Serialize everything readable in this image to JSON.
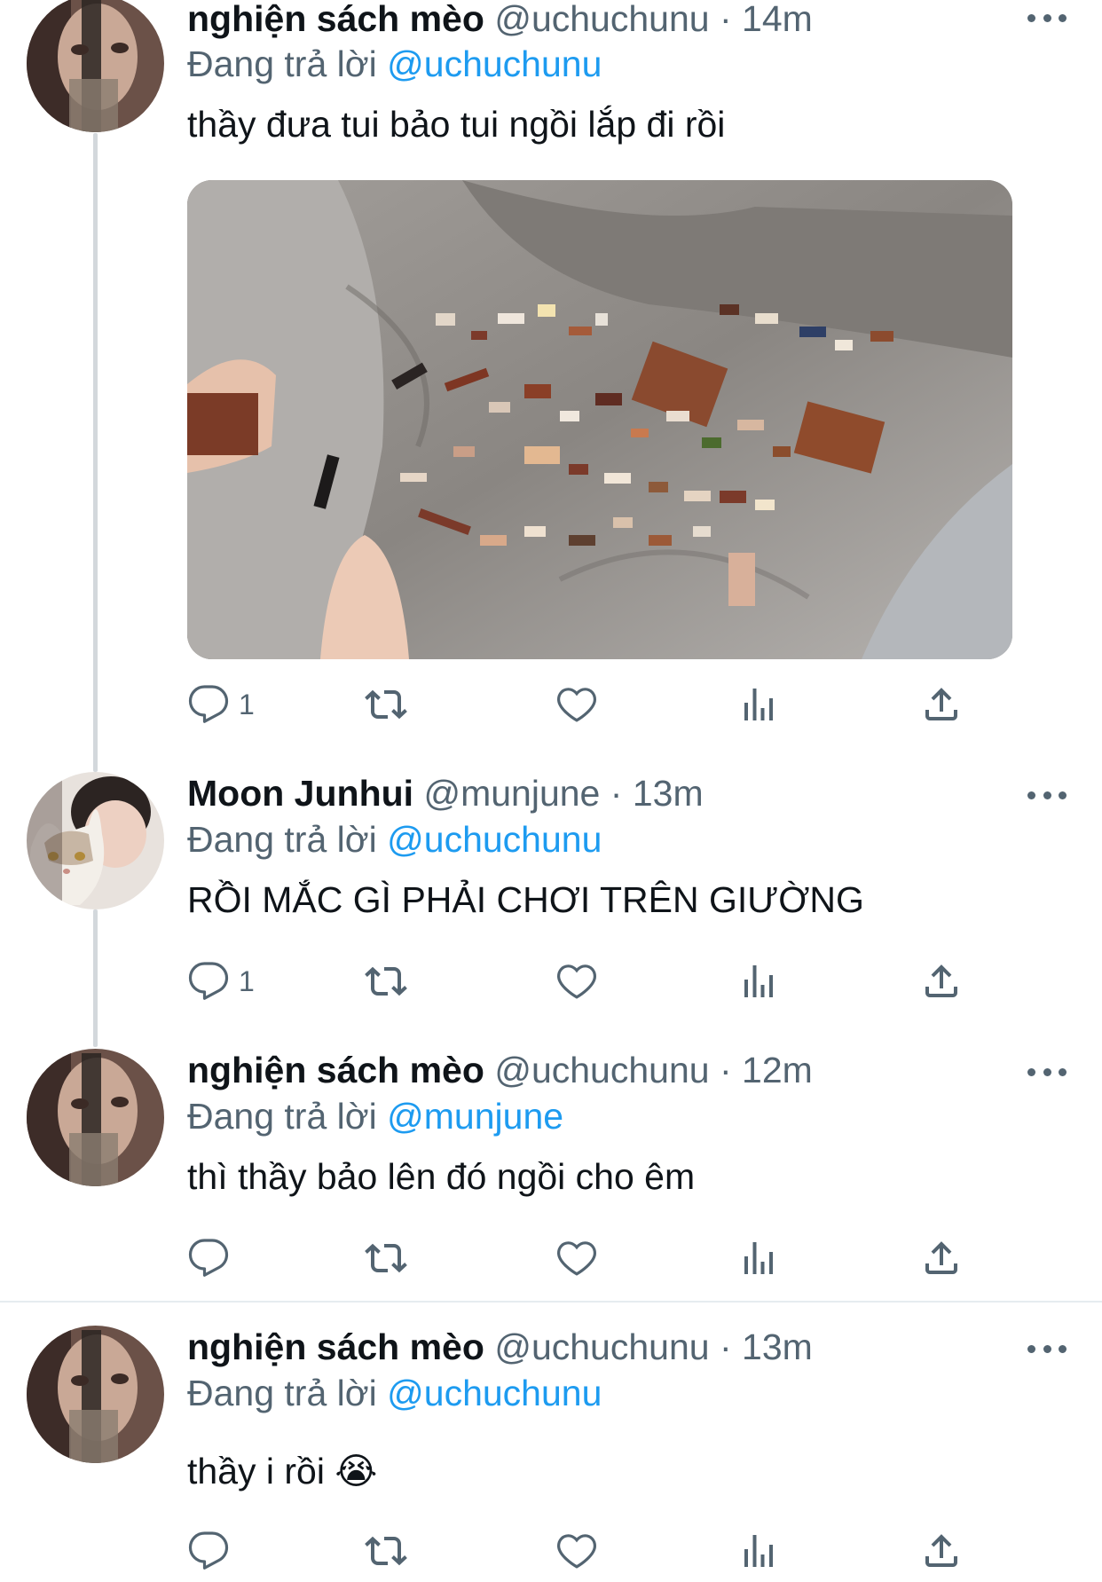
{
  "colors": {
    "link": "#1d9bf0",
    "secondary": "#536471",
    "text": "#0f1419",
    "thread_line": "#d3d8dc"
  },
  "tweets": [
    {
      "name": "nghiện sách mèo",
      "handle": "@uchuchunu",
      "separator": "·",
      "time": "14m",
      "reply_prefix": "Đang trả lời",
      "reply_to": "@uchuchunu",
      "text": "thầy đưa tui bảo tui ngồi lắp đi rồi",
      "reply_count": "1",
      "has_media": true
    },
    {
      "name": "Moon Junhui",
      "handle": "@munjune",
      "separator": "·",
      "time": "13m",
      "reply_prefix": "Đang trả lời",
      "reply_to": "@uchuchunu",
      "text": "RỒI MẮC GÌ PHẢI CHƠI TRÊN GIƯỜNG",
      "reply_count": "1"
    },
    {
      "name": "nghiện sách mèo",
      "handle": "@uchuchunu",
      "separator": "·",
      "time": "12m",
      "reply_prefix": "Đang trả lời",
      "reply_to": "@munjune",
      "text": "thì thầy bảo lên đó ngồi cho êm",
      "reply_count": ""
    },
    {
      "name": "nghiện sách mèo",
      "handle": "@uchuchunu",
      "separator": "·",
      "time": "13m",
      "reply_prefix": "Đang trả lời",
      "reply_to": "@uchuchunu",
      "text": "thầy i rồi 😭",
      "reply_count": ""
    }
  ],
  "icons": {
    "reply": "reply-icon",
    "retweet": "retweet-icon",
    "like": "heart-icon",
    "views": "views-icon",
    "share": "share-icon",
    "more": "more-icon"
  }
}
